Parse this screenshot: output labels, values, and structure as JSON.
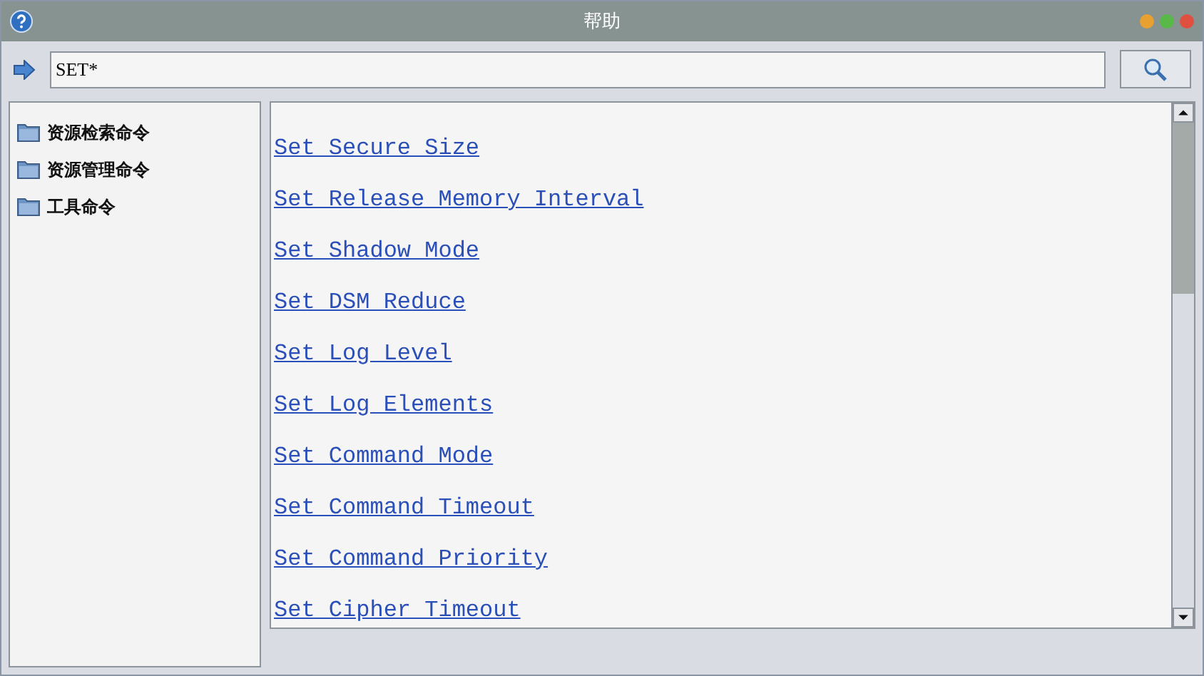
{
  "window": {
    "title": "帮助"
  },
  "search": {
    "value": "SET*"
  },
  "tree": {
    "items": [
      {
        "label": "资源检索命令"
      },
      {
        "label": "资源管理命令"
      },
      {
        "label": "工具命令"
      }
    ]
  },
  "results": {
    "links": [
      "Set Secure Size",
      "Set Release Memory Interval",
      "Set Shadow Mode",
      "Set DSM Reduce",
      "Set Log Level",
      "Set Log Elements",
      "Set Command Mode",
      "Set Command Timeout",
      "Set Command Priority",
      "Set Cipher Timeout"
    ]
  }
}
